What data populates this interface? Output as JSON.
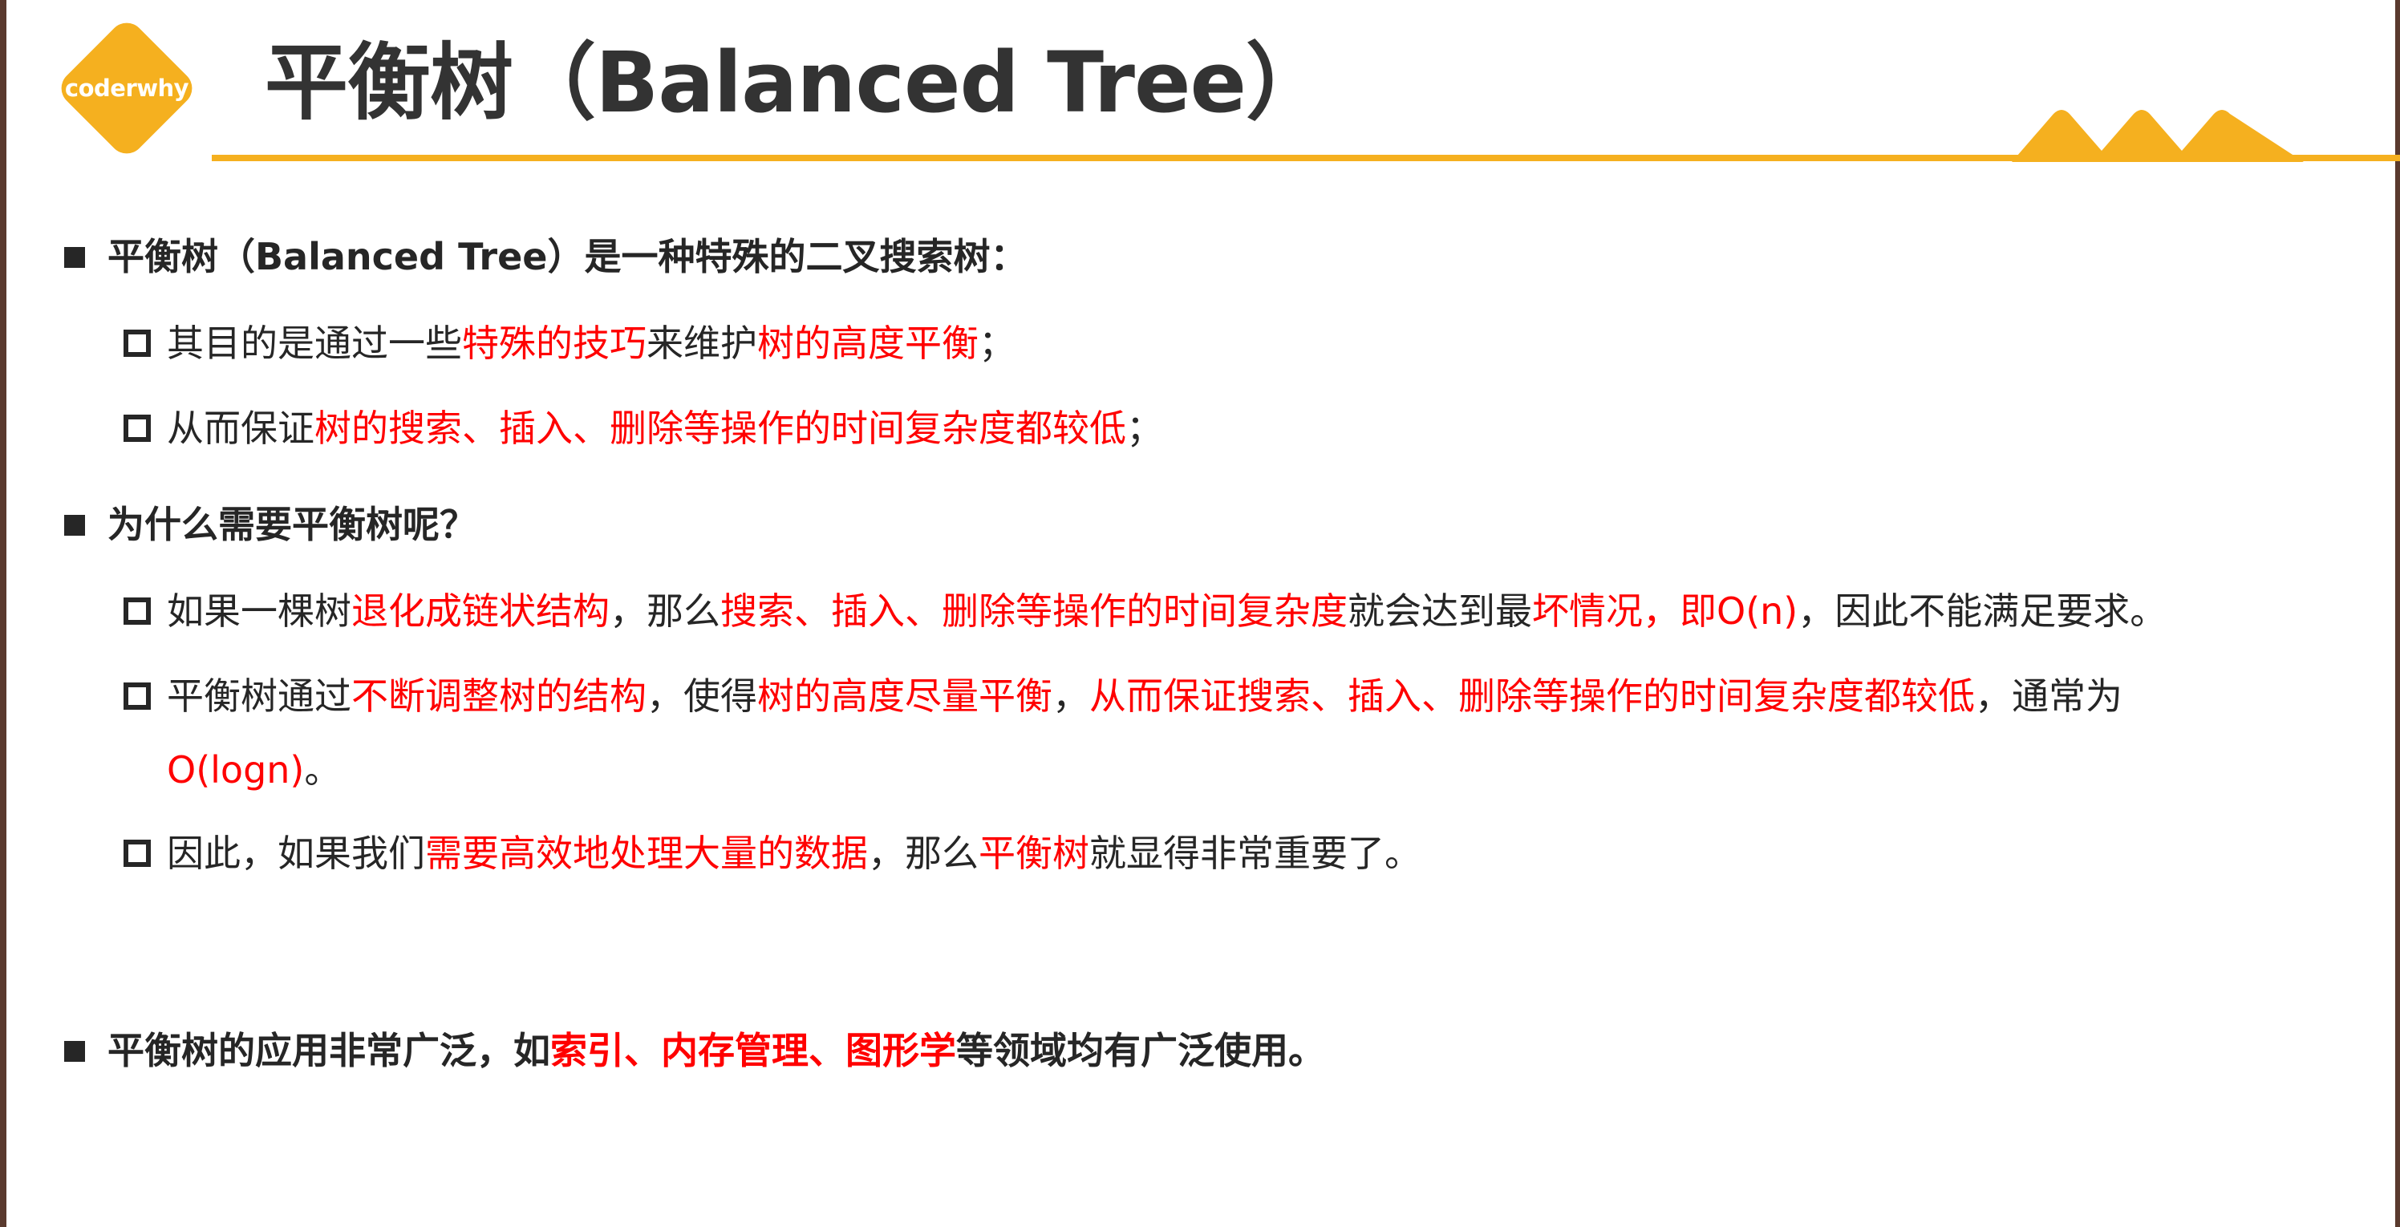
{
  "logo": {
    "text": "coderwhy"
  },
  "title": "平衡树（Balanced Tree）",
  "colors": {
    "accent": "#f5b01f",
    "highlight": "#ff0000",
    "text": "#262626",
    "title": "#333333"
  },
  "sections": [
    {
      "heading": "平衡树（Balanced Tree）是一种特殊的二叉搜索树：",
      "items": [
        {
          "parts": [
            {
              "text": "其目的是通过一些",
              "hl": false
            },
            {
              "text": "特殊的技巧",
              "hl": true
            },
            {
              "text": "来维护",
              "hl": false
            },
            {
              "text": "树的高度平衡",
              "hl": true
            },
            {
              "text": "；",
              "hl": false
            }
          ]
        },
        {
          "parts": [
            {
              "text": "从而保证",
              "hl": false
            },
            {
              "text": "树的搜索、插入、删除等操作的时间复杂度都较低",
              "hl": true
            },
            {
              "text": "；",
              "hl": false
            }
          ]
        }
      ]
    },
    {
      "heading": "为什么需要平衡树呢？",
      "items": [
        {
          "parts": [
            {
              "text": "如果一棵树",
              "hl": false
            },
            {
              "text": "退化成链状结构",
              "hl": true
            },
            {
              "text": "，那么",
              "hl": false
            },
            {
              "text": "搜索、插入、删除等操作的时间复杂度",
              "hl": true
            },
            {
              "text": "就会达到最",
              "hl": false
            },
            {
              "text": "坏情况，即O(n)",
              "hl": true
            },
            {
              "text": "，因此不能满足要求。",
              "hl": false
            }
          ]
        },
        {
          "parts": [
            {
              "text": "平衡树通过",
              "hl": false
            },
            {
              "text": "不断调整树的结构",
              "hl": true
            },
            {
              "text": "，使得",
              "hl": false
            },
            {
              "text": "树的高度尽量平衡",
              "hl": true
            },
            {
              "text": "，",
              "hl": false
            },
            {
              "text": "从而保证搜索、插入、删除等操作的时间复杂度都较低",
              "hl": true
            },
            {
              "text": "，通常为",
              "hl": false
            }
          ],
          "continuation": [
            {
              "text": "O(logn)",
              "hl": true
            },
            {
              "text": "。",
              "hl": false
            }
          ]
        },
        {
          "parts": [
            {
              "text": "因此，如果我们",
              "hl": false
            },
            {
              "text": "需要高效地处理大量的数据",
              "hl": true
            },
            {
              "text": "，那么",
              "hl": false
            },
            {
              "text": "平衡树",
              "hl": true
            },
            {
              "text": "就显得非常重要了。",
              "hl": false
            }
          ]
        }
      ]
    },
    {
      "heading_parts": [
        {
          "text": "平衡树的应用非常广泛，如",
          "hl": false
        },
        {
          "text": "索引、内存管理、图形学",
          "hl": true
        },
        {
          "text": "等领域均有广泛使用。",
          "hl": false
        }
      ],
      "items": []
    }
  ]
}
